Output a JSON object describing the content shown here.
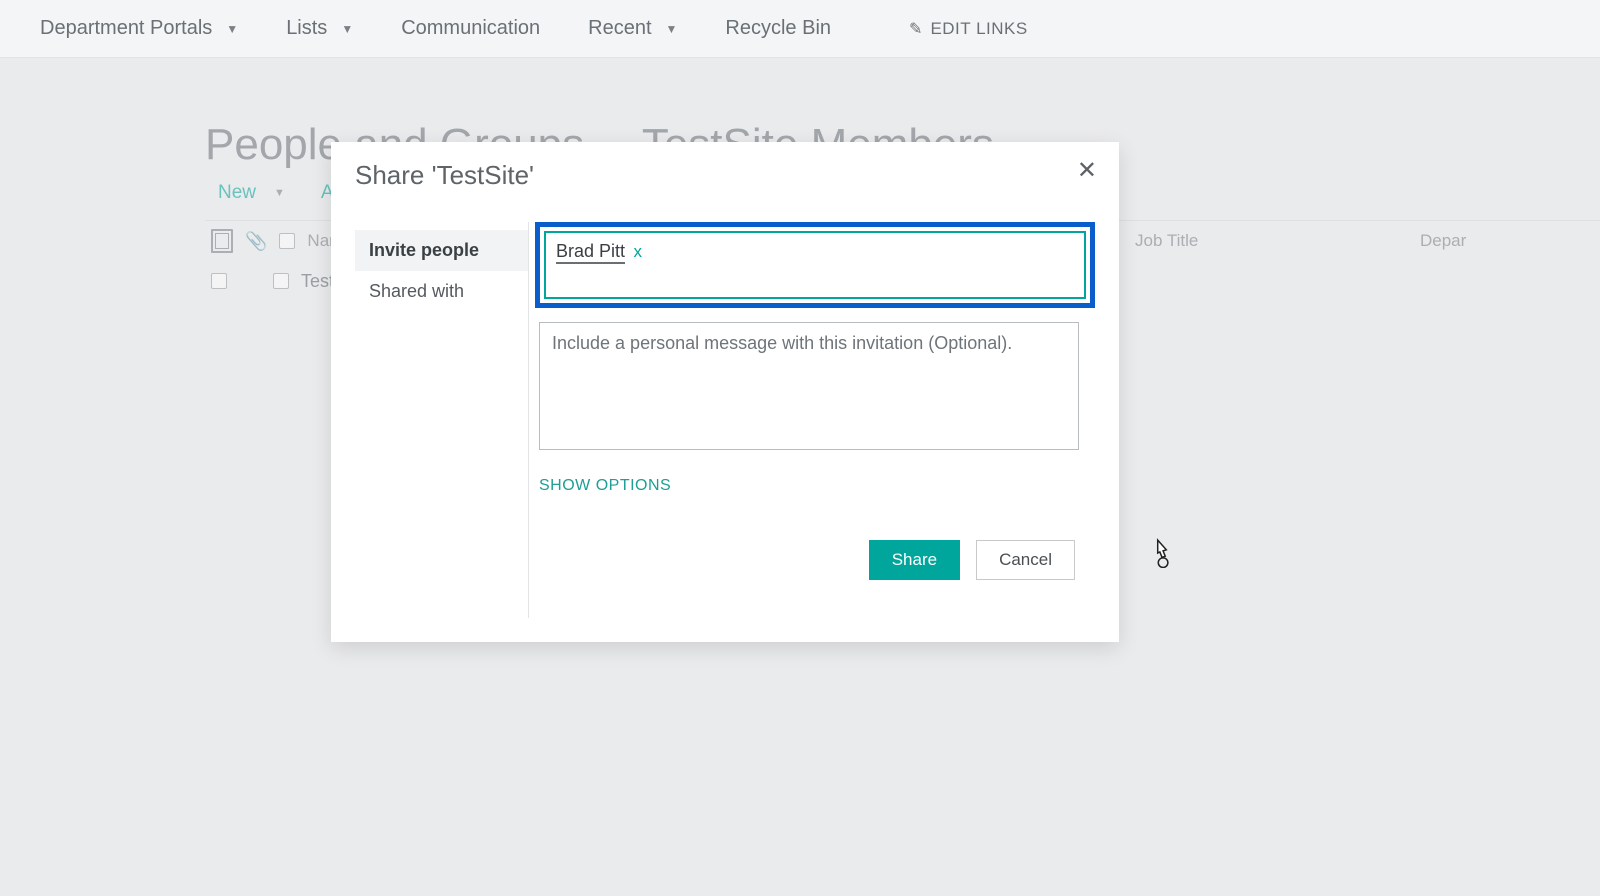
{
  "topnav": {
    "items": [
      {
        "label": "Department Portals",
        "has_caret": true
      },
      {
        "label": "Lists",
        "has_caret": true
      },
      {
        "label": "Communication",
        "has_caret": false
      },
      {
        "label": "Recent",
        "has_caret": true
      },
      {
        "label": "Recycle Bin",
        "has_caret": false
      }
    ],
    "edit_links": "EDIT LINKS"
  },
  "page": {
    "breadcrumb_main": "People and Groups",
    "breadcrumb_sub": "TestSite Members",
    "toolbar": {
      "new_label": "New",
      "actions_prefix": "Act"
    },
    "columns": {
      "name": "Nam",
      "job_title": "Job Title",
      "department": "Depar"
    },
    "rows": [
      {
        "name_prefix": "Test"
      }
    ]
  },
  "modal": {
    "title": "Share 'TestSite'",
    "side": {
      "invite": "Invite people",
      "shared_with": "Shared with"
    },
    "people_chip": {
      "name": "Brad Pitt",
      "remove": "x"
    },
    "message_placeholder": "Include a personal message with this invitation (Optional).",
    "show_options": "SHOW OPTIONS",
    "share_btn": "Share",
    "cancel_btn": "Cancel"
  }
}
